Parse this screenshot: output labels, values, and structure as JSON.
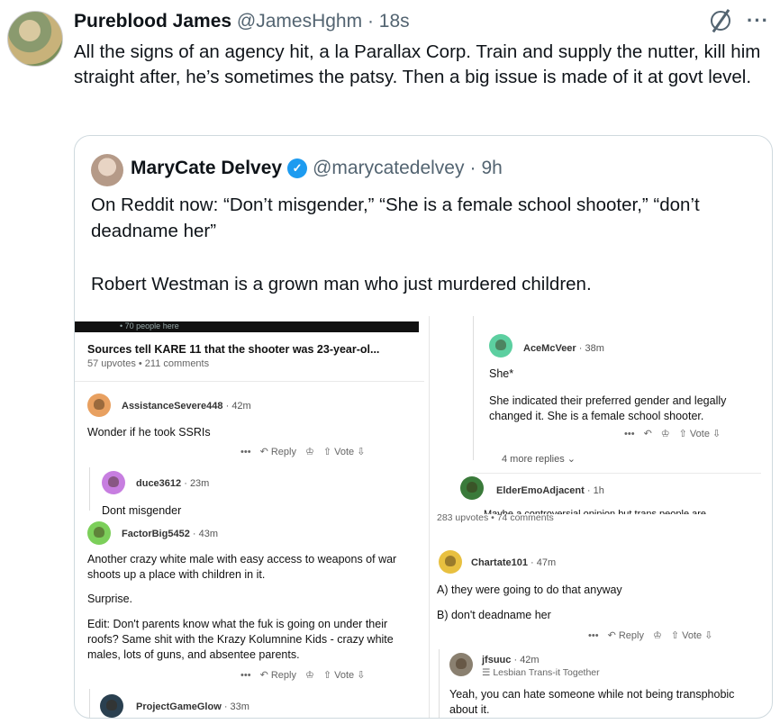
{
  "tweet": {
    "name": "Pureblood James",
    "handle": "@JamesHghm",
    "dot": "·",
    "time": "18s",
    "text": "All the signs of an agency hit, a la Parallax Corp. Train and supply the nutter, kill him straight after, he’s sometimes the patsy.  Then a big issue is made of it at govt level."
  },
  "quote": {
    "name": "MaryCate Delvey",
    "verified": "✓",
    "handle": "@marycatedelvey",
    "dot": "·",
    "time": "9h",
    "para1": "On Reddit now: “Don’t misgender,” “She is a female school shooter,” “don’t deadname her”",
    "para2": "Robert Westman is a grown man who just murdered children."
  },
  "reddit": {
    "top_bar_text": "• 70 people here",
    "post_title": "Sources tell KARE 11 that the shooter was 23-year-ol...",
    "post_meta": "57 upvotes • 211 comments",
    "action_more": "•••",
    "action_reply": "↶ Reply",
    "action_award": "♔",
    "action_vote": "⇧ Vote ⇩",
    "comments_left": [
      {
        "user": "AssistanceSevere448",
        "time": "· 42m",
        "text": "Wonder if he took SSRIs",
        "color": "#e8a060"
      },
      {
        "user": "duce3612",
        "time": "· 23m",
        "text": "Dont misgender",
        "color": "#c77ee0"
      },
      {
        "user": "FactorBig5452",
        "time": "· 43m",
        "text1": "Another crazy white male with easy access to weapons of war shoots up a place with children in it.",
        "text2": "Surprise.",
        "text3": "Edit: Don't parents know what the fuk is going on under their roofs? Same shit with the Krazy Kolumnine Kids - crazy white males, lots of guns, and absentee parents.",
        "color": "#7ccf5a"
      },
      {
        "user": "ProjectGameGlow",
        "time": "· 33m",
        "color": "#2a4050"
      }
    ],
    "comments_right_top": [
      {
        "user": "AceMcVeer",
        "time": "· 38m",
        "text1": "She*",
        "text2": "She indicated their preferred gender and legally changed it. She is a female school shooter.",
        "color": "#5ccfa0"
      },
      {
        "more_replies": "4 more replies  ⌄"
      },
      {
        "user": "ElderEmoAdjacent",
        "time": "· 1h",
        "text": "Maybe a controversial opinion but trans people are",
        "color": "#3a7a3a"
      },
      {
        "meta": "283 upvotes • 74 comments"
      }
    ],
    "comments_right_bottom": [
      {
        "user": "Chartate101",
        "time": "· 47m",
        "text1": "A) they were going to do that anyway",
        "text2": "B) don't deadname her",
        "color": "#e8c040"
      },
      {
        "user": "jfsuuc",
        "time": "· 42m",
        "flair": "☰ Lesbian Trans-it Together",
        "text": "Yeah, you can hate someone while not being transphobic about it.",
        "color": "#8a8070"
      }
    ]
  }
}
